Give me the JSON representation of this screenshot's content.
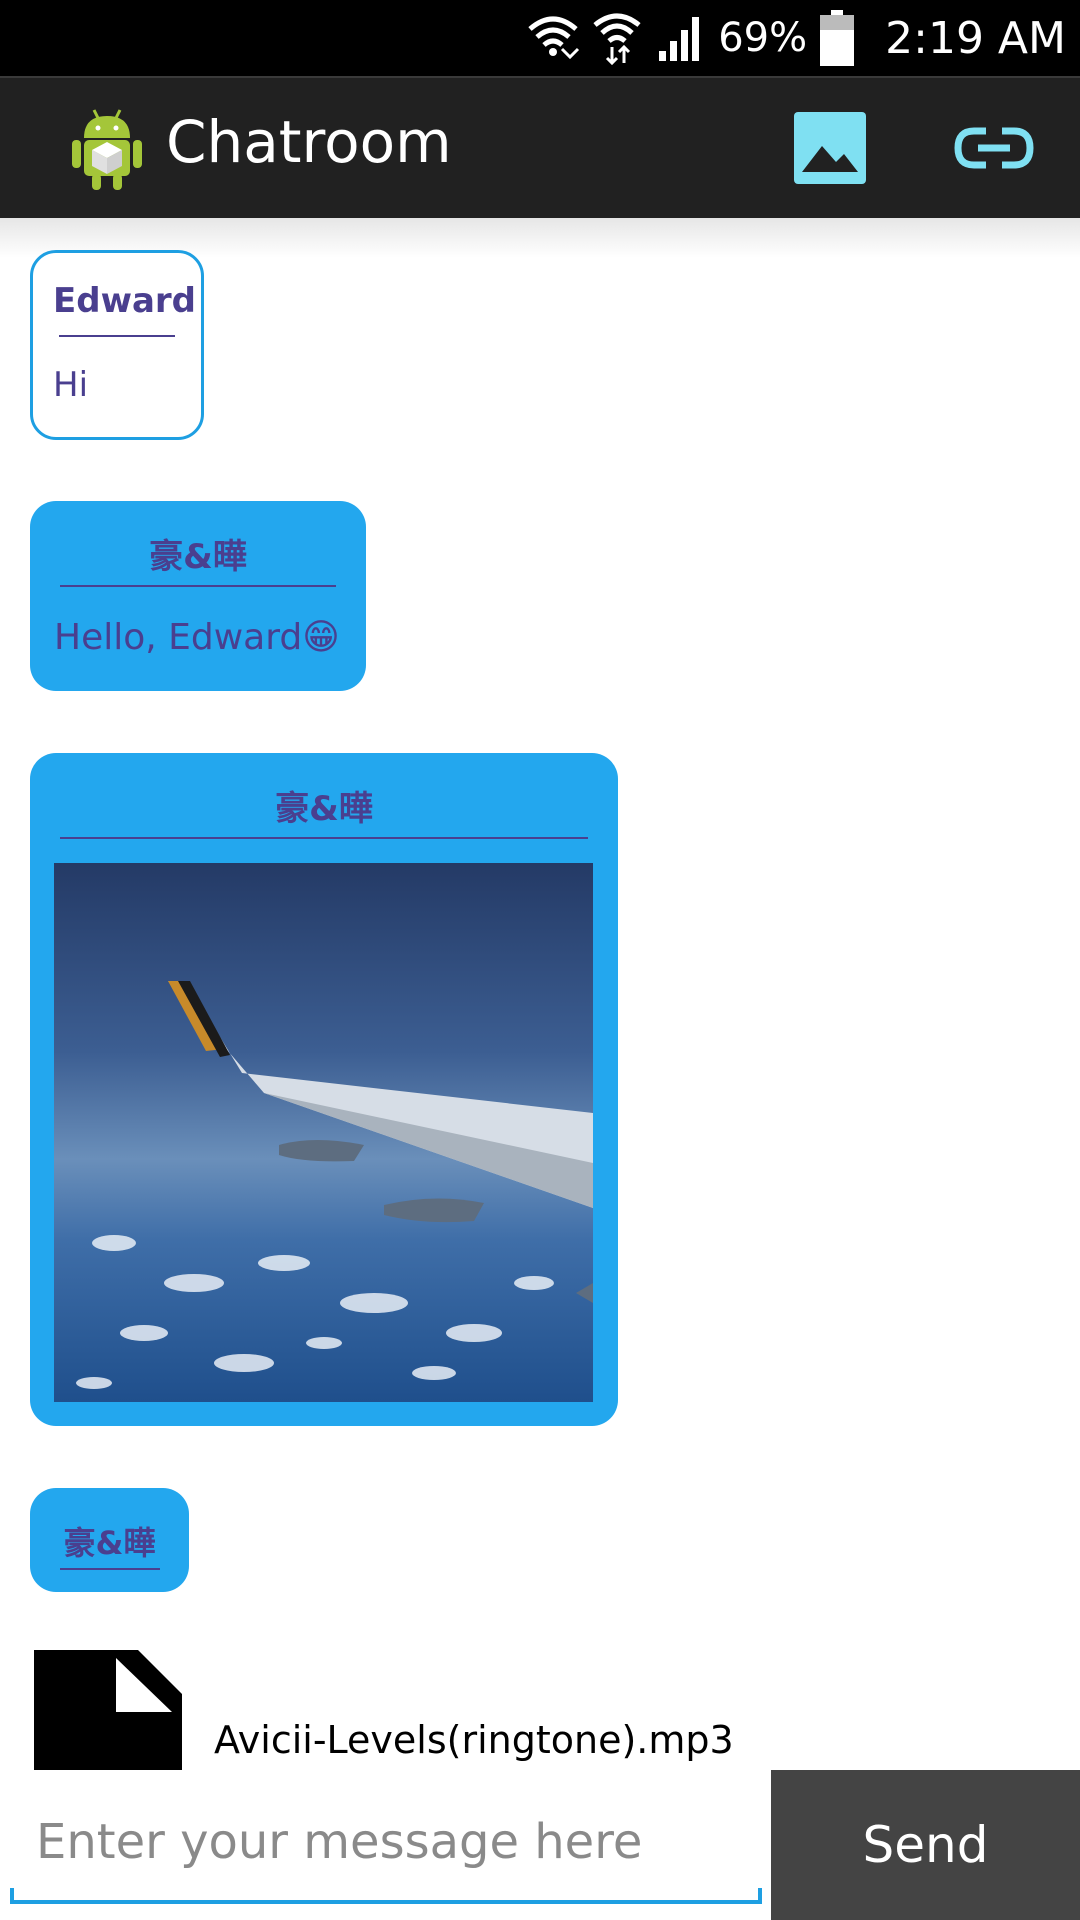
{
  "status_bar": {
    "battery": "69%",
    "time": "2:19 AM",
    "icons": [
      "wifi-calling-icon",
      "wifi-icon",
      "signal-icon",
      "battery-icon"
    ]
  },
  "action_bar": {
    "title": "Chatroom",
    "app_icon": "android-icon",
    "actions": [
      "image-icon",
      "link-icon"
    ]
  },
  "messages": [
    {
      "sender": "Edward",
      "text": "Hi",
      "style": "outlined"
    },
    {
      "sender": "豪&曄",
      "text": "Hello, Edward😁",
      "style": "filled"
    },
    {
      "sender": "豪&曄",
      "image": "airplane-wing-photo",
      "style": "filled"
    },
    {
      "sender": "豪&曄",
      "style": "filled"
    }
  ],
  "attachment": {
    "file_name": "Avicii-Levels(ringtone).mp3",
    "icon": "file-icon"
  },
  "composer": {
    "placeholder": "Enter your message here",
    "send_label": "Send"
  },
  "colors": {
    "accent": "#23a7ee",
    "sender_text": "#4a3f8f",
    "actionbar": "#212121",
    "send_button": "#444444"
  }
}
